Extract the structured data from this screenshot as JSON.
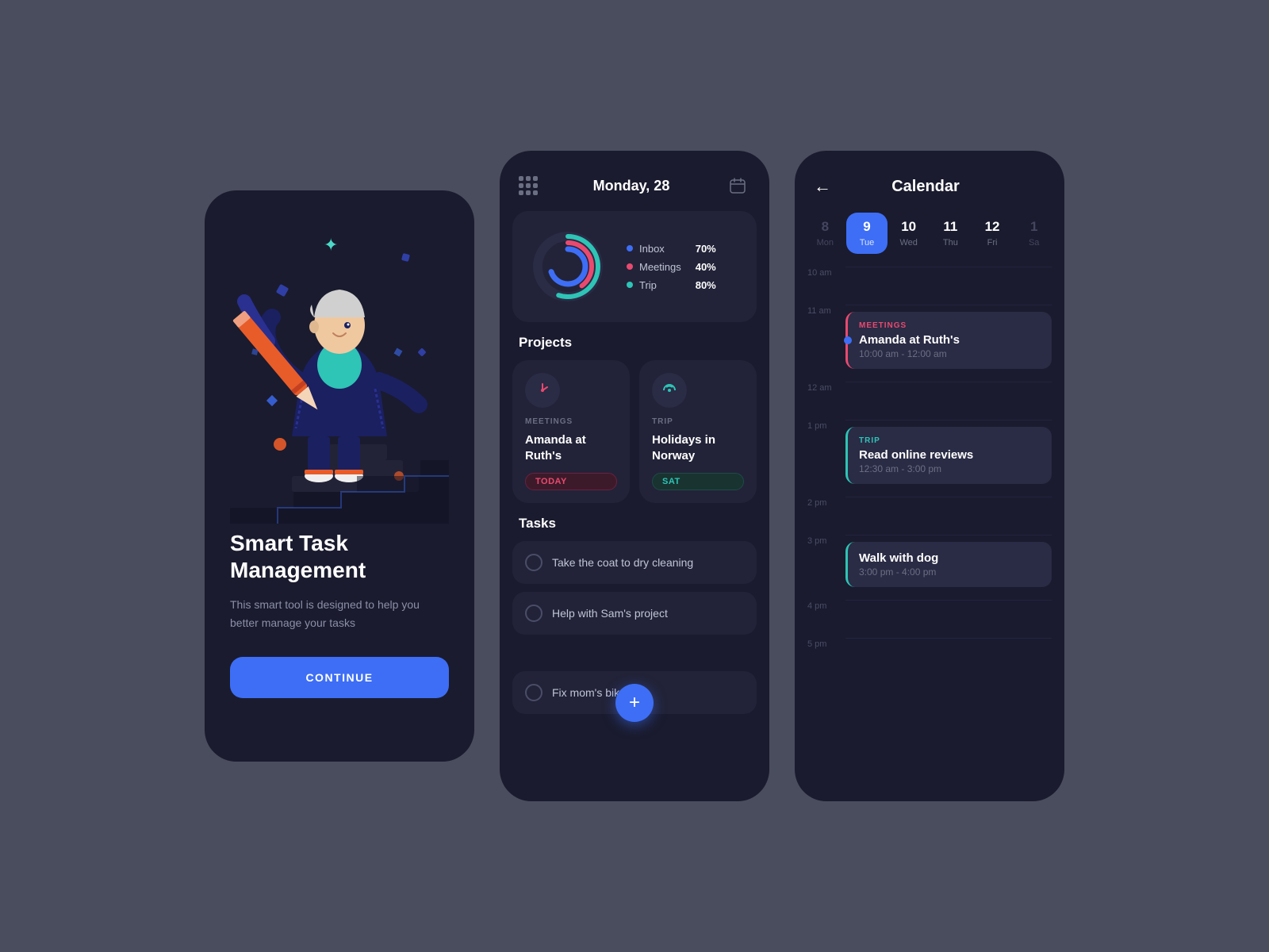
{
  "onboarding": {
    "title": "Smart Task Management",
    "subtitle": "This smart tool is designed to help you better manage your tasks",
    "continue_label": "CONTINUE"
  },
  "dashboard": {
    "header": {
      "date": "Monday, 28"
    },
    "chart": {
      "items": [
        {
          "label": "Inbox",
          "pct": "70%",
          "color": "#3d6ef5"
        },
        {
          "label": "Meetings",
          "pct": "40%",
          "color": "#e84a6f"
        },
        {
          "label": "Trip",
          "pct": "80%",
          "color": "#2ec4b6"
        }
      ]
    },
    "projects_title": "Projects",
    "projects": [
      {
        "category": "MEETINGS",
        "name": "Amanda at Ruth's",
        "tag": "TODAY",
        "tag_type": "today"
      },
      {
        "category": "TRIP",
        "name": "Holidays in Norway",
        "tag": "SAT",
        "tag_type": "sat"
      }
    ],
    "tasks_title": "Tasks",
    "tasks": [
      {
        "text": "Take the coat to dry cleaning"
      },
      {
        "text": "Help with Sam's project"
      },
      {
        "text": "Fix mom's bike"
      }
    ]
  },
  "calendar": {
    "title": "Calendar",
    "days": [
      {
        "num": "8",
        "label": "Mon",
        "state": "dimmed"
      },
      {
        "num": "9",
        "label": "Tue",
        "state": "active"
      },
      {
        "num": "10",
        "label": "Wed",
        "state": "normal"
      },
      {
        "num": "11",
        "label": "Thu",
        "state": "normal"
      },
      {
        "num": "12",
        "label": "Fri",
        "state": "normal"
      },
      {
        "num": "1",
        "label": "Sa",
        "state": "dimmed"
      }
    ],
    "time_slots": [
      {
        "time": "10 am",
        "event": null
      },
      {
        "time": "11 am",
        "event": {
          "type": "meetings",
          "category": "MEETINGS",
          "title": "Amanda at Ruth's",
          "time_range": "10:00 am - 12:00 am",
          "has_dot": true
        }
      },
      {
        "time": "12 am",
        "event": null
      },
      {
        "time": "1 pm",
        "event": {
          "type": "trip",
          "category": "TRIP",
          "title": "Read online reviews",
          "time_range": "12:30 am - 3:00 pm"
        }
      },
      {
        "time": "2 pm",
        "event": null
      },
      {
        "time": "3 pm",
        "event": {
          "type": "walk",
          "category": "",
          "title": "Walk with dog",
          "time_range": "3:00 pm - 4:00 pm"
        }
      },
      {
        "time": "4 pm",
        "event": null
      },
      {
        "time": "5 pm",
        "event": null
      }
    ]
  }
}
